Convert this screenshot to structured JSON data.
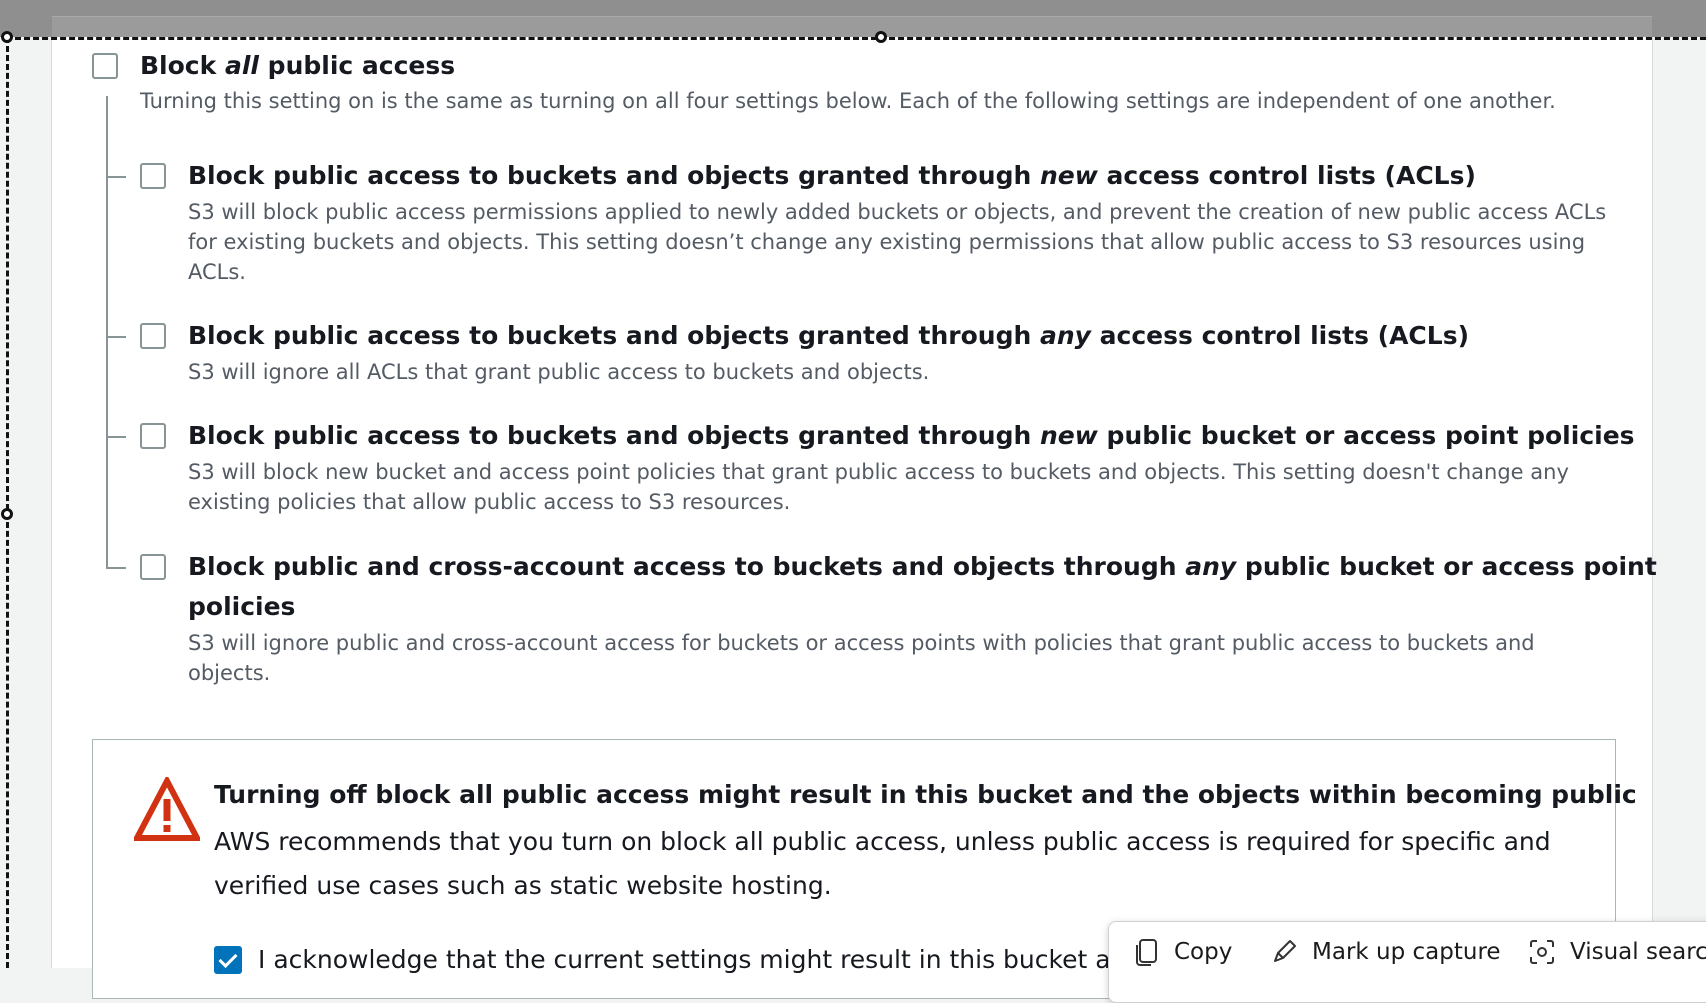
{
  "block_all": {
    "title_pre": "Block ",
    "title_em": "all",
    "title_post": " public access",
    "description": "Turning this setting on is the same as turning on all four settings below. Each of the following settings are independent of one another.",
    "checked": false
  },
  "options": [
    {
      "title_pre": "Block public access to buckets and objects granted through ",
      "title_em": "new",
      "title_post": " access control lists (ACLs)",
      "description": "S3 will block public access permissions applied to newly added buckets or objects, and prevent the creation of new public access ACLs for existing buckets and objects. This setting doesn’t change any existing permissions that allow public access to S3 resources using ACLs.",
      "checked": false
    },
    {
      "title_pre": "Block public access to buckets and objects granted through ",
      "title_em": "any",
      "title_post": " access control lists (ACLs)",
      "description": "S3 will ignore all ACLs that grant public access to buckets and objects.",
      "checked": false
    },
    {
      "title_pre": "Block public access to buckets and objects granted through ",
      "title_em": "new",
      "title_post": " public bucket or access point policies",
      "description": "S3 will block new bucket and access point policies that grant public access to buckets and objects. This setting doesn't change any existing policies that allow public access to S3 resources.",
      "checked": false
    },
    {
      "title_pre": "Block public and cross-account access to buckets and objects through ",
      "title_em": "any",
      "title_post": " public bucket or access point",
      "title_line2": "policies",
      "description": "S3 will ignore public and cross-account access for buckets or access points with policies that grant public access to buckets and objects.",
      "checked": false
    }
  ],
  "warning": {
    "title": "Turning off block all public access might result in this bucket and the objects within becoming public",
    "text": "AWS recommends that you turn on block all public access, unless public access is required for specific and verified use cases such as static website hosting.",
    "acknowledge_text": "I acknowledge that the current settings might result in this bucket a",
    "acknowledge_checked": true
  },
  "snip_toolbar": {
    "copy_label": "Copy",
    "markup_label": "Mark up capture",
    "visual_search_label": "Visual searc"
  },
  "colors": {
    "warning_red": "#d13212",
    "checkbox_blue": "#0073bb"
  }
}
